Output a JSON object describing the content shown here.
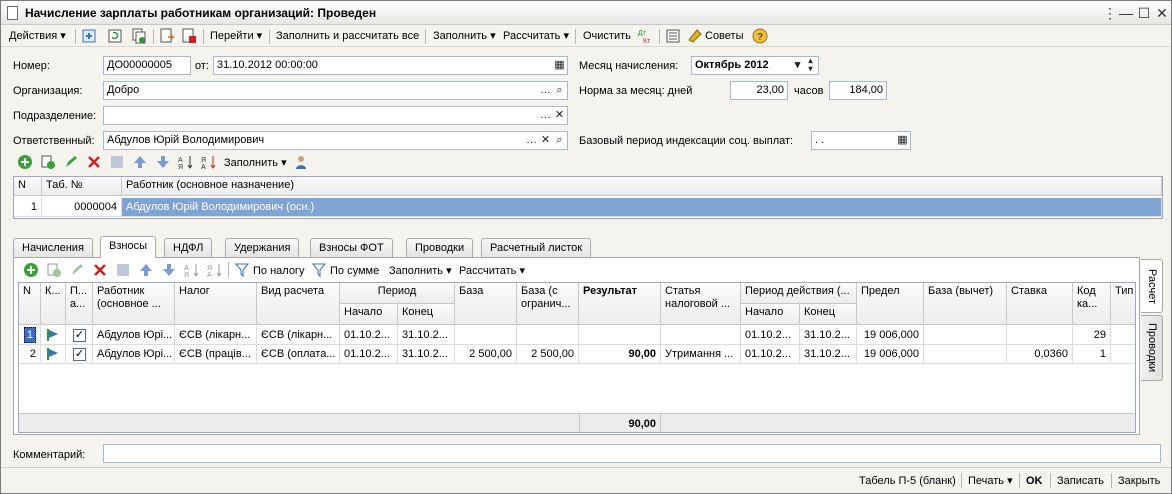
{
  "window": {
    "title": "Начисление зарплаты работникам организаций: Проведен"
  },
  "toolbar": {
    "actions": "Действия",
    "goto": "Перейти",
    "fill_calc_all": "Заполнить и рассчитать все",
    "fill": "Заполнить",
    "calc": "Рассчитать",
    "clear": "Очистить",
    "tips": "Советы"
  },
  "header": {
    "number_label": "Номер:",
    "number": "ДО00000005",
    "from_label": "от:",
    "date": "31.10.2012 00:00:00",
    "org_label": "Организация:",
    "org": "Добро",
    "dept_label": "Подразделение:",
    "dept": "",
    "resp_label": "Ответственный:",
    "resp": "Абдулов Юрій Володимирович",
    "month_label": "Месяц начисления:",
    "month": "Октябрь 2012",
    "norm_label": "Норма за месяц: дней",
    "norm_days": "23,00",
    "hours_label": "часов",
    "norm_hours": "184,00",
    "base_label": "Базовый период индексации соц. выплат:",
    "base_value": " .  ."
  },
  "emp_toolbar": {
    "fill": "Заполнить"
  },
  "emp_grid": {
    "headers": [
      "N",
      "Таб. №",
      "Работник (основное назначение)"
    ],
    "rows": [
      {
        "n": "1",
        "tab": "0000004",
        "worker": "Абдулов Юрій Володимирович (осн.)"
      }
    ]
  },
  "tabs": [
    "Начисления",
    "Взносы",
    "НДФЛ",
    "Удержания",
    "Взносы ФОТ",
    "Проводки",
    "Расчетный листок"
  ],
  "side_tabs": [
    "Расчет",
    "Проводки"
  ],
  "contrib_toolbar": {
    "by_tax": "По налогу",
    "by_sum": "По сумме",
    "fill": "Заполнить",
    "calc": "Рассчитать"
  },
  "contrib_grid": {
    "headers": {
      "n": "N",
      "k": "К...",
      "p": "П... а...",
      "worker": "Работник (основное ...",
      "tax": "Налог",
      "calc_type": "Вид расчета",
      "period": "Период",
      "start": "Начало",
      "end": "Конец",
      "base": "База",
      "base_lim": "База (с огранич...",
      "result": "Результат",
      "article": "Статья налоговой ...",
      "valid_period": "Период действия (...",
      "vstart": "Начало",
      "vend": "Конец",
      "limit": "Предел",
      "base_ded": "База (вычет)",
      "rate": "Ставка",
      "code": "Код ка...",
      "type": "Тип"
    },
    "rows": [
      {
        "n": "1",
        "worker": "Абдулов Юрі...",
        "tax": "ЄСВ (лікарн...",
        "calc_type": "ЄСВ (лікарн...",
        "start": "01.10.2...",
        "end": "31.10.2...",
        "base": "",
        "base_lim": "",
        "result": "",
        "article": "",
        "vstart": "01.10.2...",
        "vend": "31.10.2...",
        "limit": "19 006,000",
        "base_ded": "",
        "rate": "",
        "code": "29"
      },
      {
        "n": "2",
        "worker": "Абдулов Юрі...",
        "tax": "ЄСВ (праців...",
        "calc_type": "ЄСВ (оплата...",
        "start": "01.10.2...",
        "end": "31.10.2...",
        "base": "2 500,00",
        "base_lim": "2 500,00",
        "result": "90,00",
        "article": "Утримання ...",
        "vstart": "01.10.2...",
        "vend": "31.10.2...",
        "limit": "19 006,000",
        "base_ded": "",
        "rate": "0,0360",
        "code": "1"
      }
    ],
    "total_result": "90,00"
  },
  "footer": {
    "comment_label": "Комментарий:",
    "comment": "",
    "tabel": "Табель П-5 (бланк)",
    "print": "Печать",
    "ok": "OK",
    "save": "Записать",
    "close": "Закрыть"
  },
  "colors": {
    "selection": "#7fa3d4",
    "accent_blue": "#3a70c0",
    "green": "#2e9a2e",
    "red": "#d02020"
  }
}
